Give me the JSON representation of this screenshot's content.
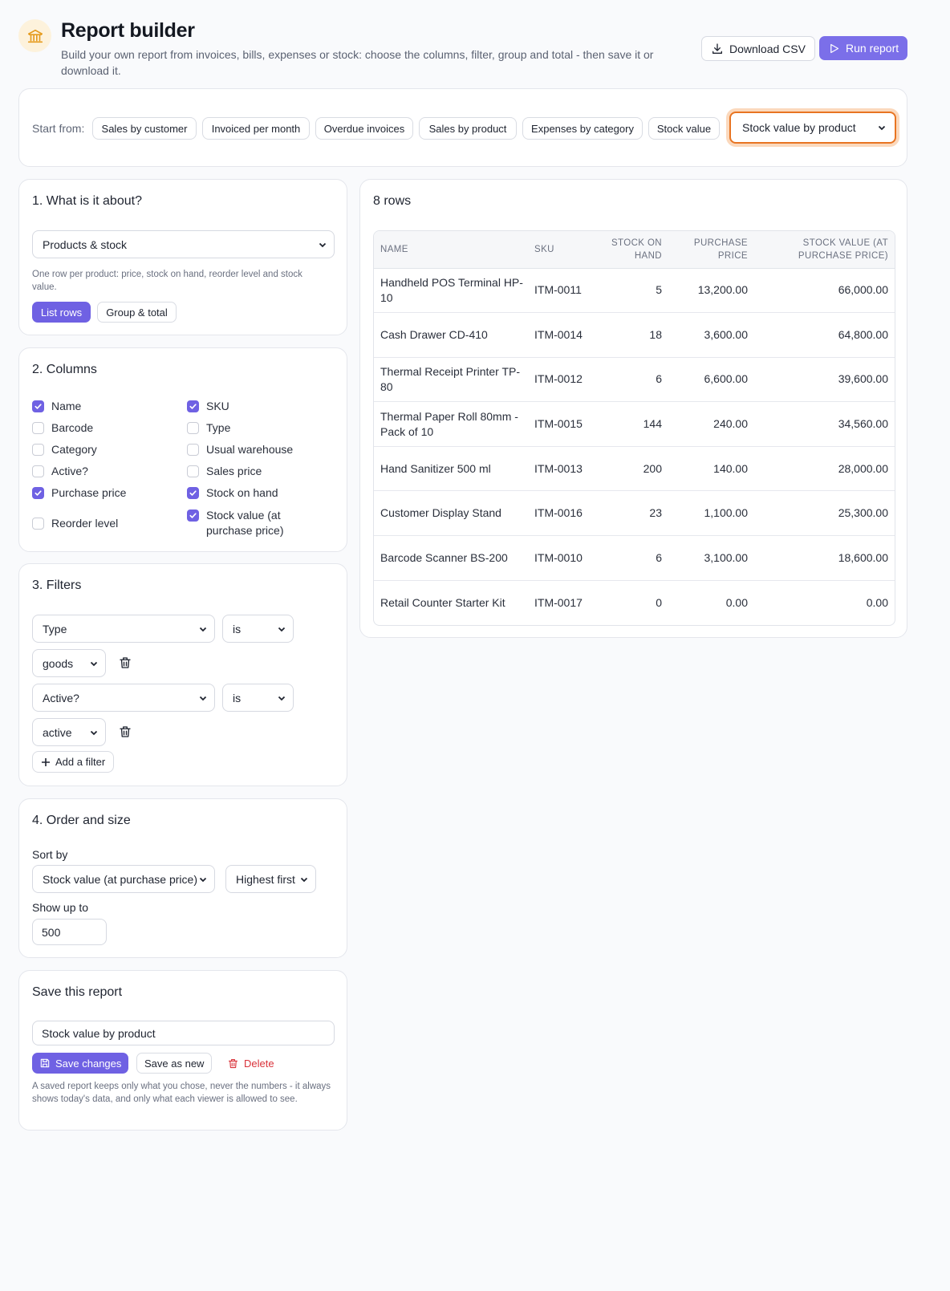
{
  "header": {
    "title": "Report builder",
    "subtitle": "Build your own report from invoices, bills, expenses or stock: choose the columns, filter, group and total - then save it or download it.",
    "download_label": "Download CSV",
    "run_label": "Run report"
  },
  "start": {
    "label": "Start from:",
    "chips": [
      "Sales by customer",
      "Invoiced per month",
      "Overdue invoices",
      "Sales by product",
      "Expenses by category",
      "Stock value"
    ],
    "saved_select": "Stock value by product"
  },
  "about": {
    "title": "1. What is it about?",
    "source": "Products & stock",
    "hint": "One row per product: price, stock on hand, reorder level and stock value.",
    "list_rows": "List rows",
    "group_total": "Group & total"
  },
  "columns": {
    "title": "2. Columns",
    "items": [
      {
        "label": "Name",
        "checked": true
      },
      {
        "label": "SKU",
        "checked": true
      },
      {
        "label": "Barcode",
        "checked": false
      },
      {
        "label": "Type",
        "checked": false
      },
      {
        "label": "Category",
        "checked": false
      },
      {
        "label": "Usual warehouse",
        "checked": false
      },
      {
        "label": "Active?",
        "checked": false
      },
      {
        "label": "Sales price",
        "checked": false
      },
      {
        "label": "Purchase price",
        "checked": true
      },
      {
        "label": "Stock on hand",
        "checked": true
      },
      {
        "label": "Reorder level",
        "checked": false
      },
      {
        "label": "Stock value (at purchase price)",
        "checked": true
      }
    ]
  },
  "filters": {
    "title": "3. Filters",
    "rows": [
      {
        "field": "Type",
        "op": "is",
        "value": "goods"
      },
      {
        "field": "Active?",
        "op": "is",
        "value": "active"
      }
    ],
    "add_label": "Add a filter"
  },
  "order": {
    "title": "4. Order and size",
    "sort_label": "Sort by",
    "sort_field": "Stock value (at purchase price)",
    "sort_dir": "Highest first",
    "limit_label": "Show up to",
    "limit": "500"
  },
  "save": {
    "title": "Save this report",
    "name": "Stock value by product",
    "save_changes": "Save changes",
    "save_new": "Save as new",
    "delete": "Delete",
    "note": "A saved report keeps only what you chose, never the numbers - it always shows today's data, and only what each viewer is allowed to see."
  },
  "results": {
    "count": "8 rows",
    "headers": [
      "Name",
      "SKU",
      "Stock on hand",
      "Purchase price",
      "Stock value (at purchase price)"
    ],
    "rows": [
      [
        "Handheld POS Terminal HP-10",
        "ITM-0011",
        "5",
        "13,200.00",
        "66,000.00"
      ],
      [
        "Cash Drawer CD-410",
        "ITM-0014",
        "18",
        "3,600.00",
        "64,800.00"
      ],
      [
        "Thermal Receipt Printer TP-80",
        "ITM-0012",
        "6",
        "6,600.00",
        "39,600.00"
      ],
      [
        "Thermal Paper Roll 80mm - Pack of 10",
        "ITM-0015",
        "144",
        "240.00",
        "34,560.00"
      ],
      [
        "Hand Sanitizer 500 ml",
        "ITM-0013",
        "200",
        "140.00",
        "28,000.00"
      ],
      [
        "Customer Display Stand",
        "ITM-0016",
        "23",
        "1,100.00",
        "25,300.00"
      ],
      [
        "Barcode Scanner BS-200",
        "ITM-0010",
        "6",
        "3,100.00",
        "18,600.00"
      ],
      [
        "Retail Counter Starter Kit",
        "ITM-0017",
        "0",
        "0.00",
        "0.00"
      ]
    ]
  },
  "colors": {
    "accent": "#6f61e3",
    "focus": "#e87422",
    "danger": "#d9323a"
  }
}
